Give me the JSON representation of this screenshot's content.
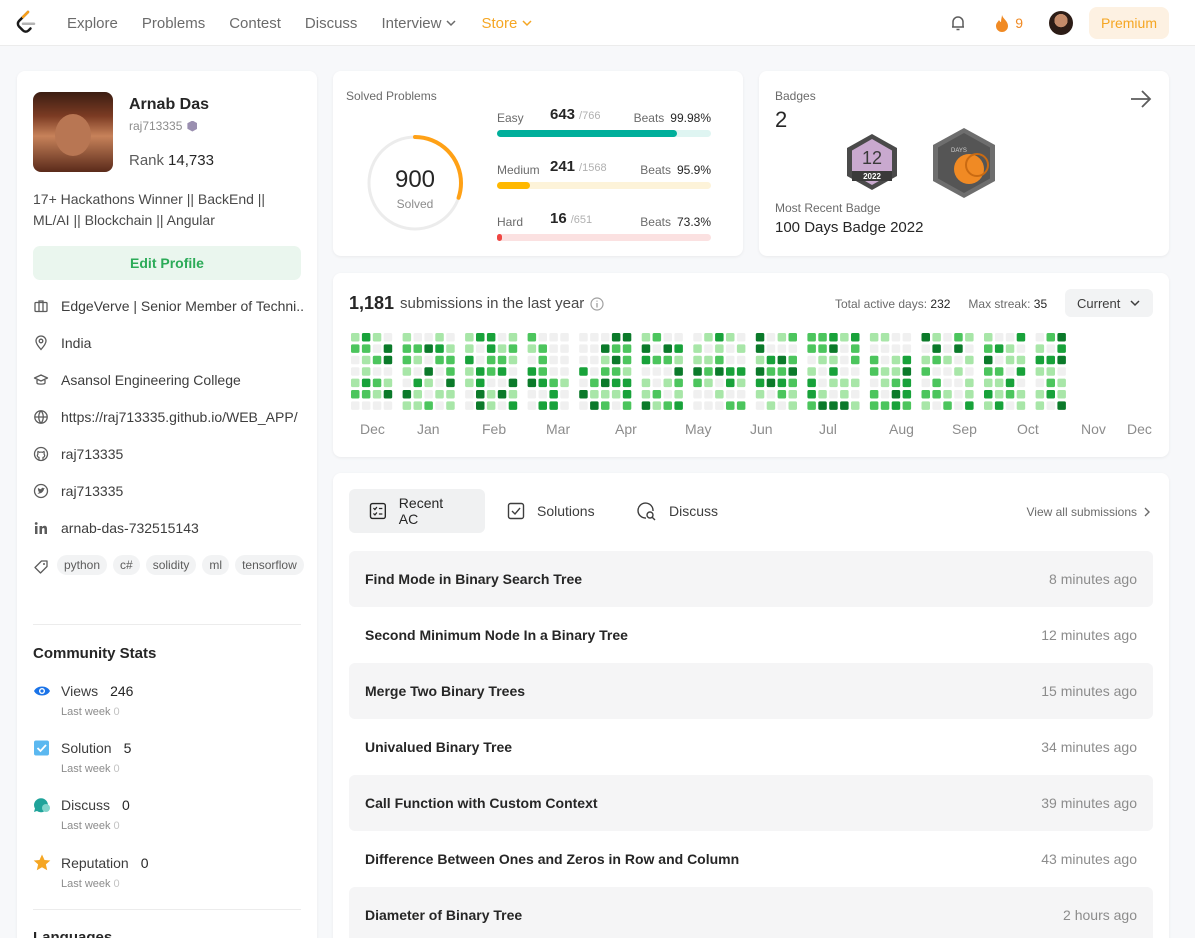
{
  "nav": {
    "links": [
      "Explore",
      "Problems",
      "Contest",
      "Discuss",
      "Interview",
      "Store"
    ],
    "streak": "9",
    "premium": "Premium"
  },
  "profile": {
    "name": "Arnab Das",
    "username": "raj713335",
    "rank_label": "Rank",
    "rank_value": "14,733",
    "bio": "17+ Hackathons Winner || BackEnd || ML/AI || Blockchain || Angular",
    "edit": "Edit Profile",
    "company": "EdgeVerve | Senior Member of Techni...",
    "location": "India",
    "school": "Asansol Engineering College",
    "website": "https://raj713335.github.io/WEB_APP/",
    "github": "raj713335",
    "twitter": "raj713335",
    "linkedin": "arnab-das-732515143",
    "tags": [
      "python",
      "c#",
      "solidity",
      "ml",
      "tensorflow"
    ]
  },
  "community": {
    "title": "Community Stats",
    "last_week": "Last week",
    "stats": [
      {
        "label": "Views",
        "value": "246",
        "delta": "0"
      },
      {
        "label": "Solution",
        "value": "5",
        "delta": "0"
      },
      {
        "label": "Discuss",
        "value": "0",
        "delta": "0"
      },
      {
        "label": "Reputation",
        "value": "0",
        "delta": "0"
      }
    ],
    "languages": "Languages"
  },
  "solved": {
    "title": "Solved Problems",
    "total": "900",
    "total_label": "Solved",
    "beats_label": "Beats",
    "levels": [
      {
        "name": "Easy",
        "count": "643",
        "total": "/766",
        "beats": "99.98%",
        "color": "#00af9b",
        "track": "#dff5f2",
        "fill": 0.839
      },
      {
        "name": "Medium",
        "count": "241",
        "total": "/1568",
        "beats": "95.9%",
        "color": "#ffb800",
        "track": "#fdf3d9",
        "fill": 0.154
      },
      {
        "name": "Hard",
        "count": "16",
        "total": "/651",
        "beats": "73.3%",
        "color": "#ef4743",
        "track": "#fbe1e1",
        "fill": 0.025
      }
    ]
  },
  "badges": {
    "title": "Badges",
    "count": "2",
    "recent_label": "Most Recent Badge",
    "recent_name": "100 Days Badge 2022",
    "badge1_top": "12",
    "badge1_year": "2022",
    "badge2_text": "DAYS"
  },
  "heatmap": {
    "count": "1,181",
    "label": "submissions in the last year",
    "active_label": "Total active days:",
    "active_value": "232",
    "streak_label": "Max streak:",
    "streak_value": "35",
    "selector": "Current",
    "months": [
      "Dec",
      "Jan",
      "Feb",
      "Mar",
      "Apr",
      "May",
      "Jun",
      "Jul",
      "Aug",
      "Sep",
      "Oct",
      "Nov",
      "Dec"
    ]
  },
  "recent": {
    "tabs": [
      "Recent AC",
      "Solutions",
      "Discuss"
    ],
    "view_all": "View all submissions",
    "items": [
      {
        "title": "Find Mode in Binary Search Tree",
        "time": "8 minutes ago"
      },
      {
        "title": "Second Minimum Node In a Binary Tree",
        "time": "12 minutes ago"
      },
      {
        "title": "Merge Two Binary Trees",
        "time": "15 minutes ago"
      },
      {
        "title": "Univalued Binary Tree",
        "time": "34 minutes ago"
      },
      {
        "title": "Call Function with Custom Context",
        "time": "39 minutes ago"
      },
      {
        "title": "Difference Between Ones and Zeros in Row and Column",
        "time": "43 minutes ago"
      },
      {
        "title": "Diameter of Binary Tree",
        "time": "2 hours ago"
      }
    ]
  },
  "colors": {
    "heat_levels": [
      "#f0f0f0",
      "#a8e6a8",
      "#4cc55d",
      "#18a23a",
      "#0b7a2a"
    ],
    "accent": "#f5a623"
  }
}
